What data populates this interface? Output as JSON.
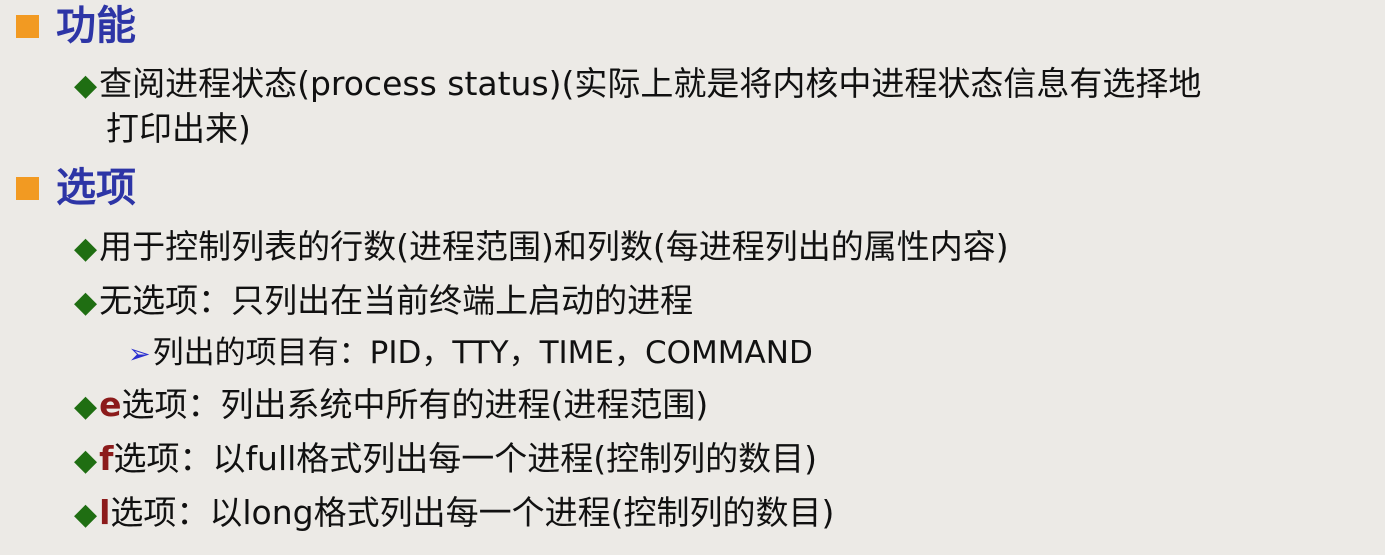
{
  "headings": {
    "function": "功能",
    "options": "选项"
  },
  "items": {
    "ps_desc_1": "查阅进程状态(process status)(实际上就是将内核中进程状态信息有选择地",
    "ps_desc_2": "打印出来)",
    "opt_control": "用于控制列表的行数(进程范围)和列数(每进程列出的属性内容)",
    "opt_none": "无选项：只列出在当前终端上启动的进程",
    "opt_none_sub": "列出的项目有：PID，TTY，TIME，COMMAND",
    "opt_e_key": "e",
    "opt_e_text": "选项：列出系统中所有的进程(进程范围)",
    "opt_f_key": "f",
    "opt_f_text": "选项：以full格式列出每一个进程(控制列的数目)",
    "opt_l_key": "l",
    "opt_l_text": "选项：以long格式列出每一个进程(控制列的数目)"
  },
  "icons": {
    "heading_marker": "orange-square-icon",
    "bullet_marker": "green-diamond-icon",
    "sub_marker": "blue-arrow-icon"
  },
  "colors": {
    "heading": "#2d35a6",
    "heading_marker": "#f29a22",
    "bullet_marker": "#1f6e12",
    "option_key": "#8c1b1b",
    "sub_marker": "#2a2fd0",
    "background": "#eceae6"
  }
}
